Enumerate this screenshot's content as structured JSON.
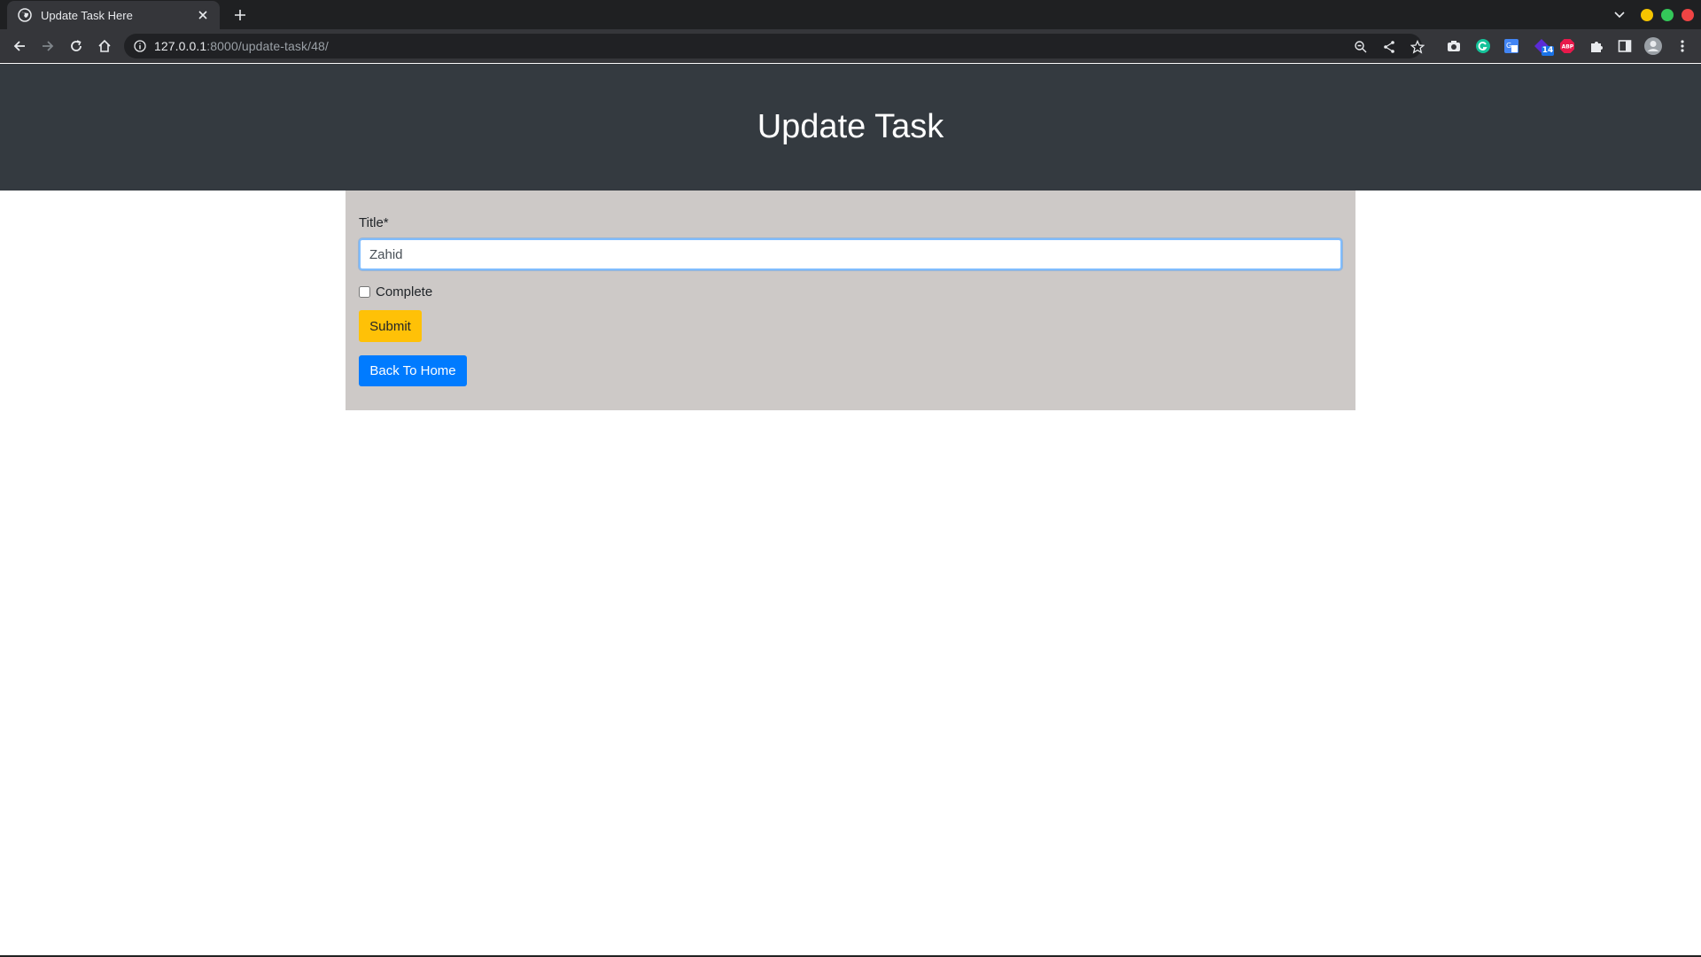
{
  "browser": {
    "tab_title": "Update Task Here",
    "url_host": "127.0.0.1",
    "url_path": ":8000/update-task/48/",
    "extension_badge": "14",
    "window_colors": {
      "minimize": "#f5c400",
      "maximize": "#34c759",
      "close": "#ef4444"
    }
  },
  "page": {
    "heading": "Update Task",
    "form": {
      "title_label": "Title*",
      "title_value": "Zahid",
      "complete_label": "Complete",
      "submit_label": "Submit",
      "back_label": "Back To Home"
    }
  },
  "colors": {
    "hero_bg": "#343a40",
    "card_bg": "#cdc9c7",
    "submit_bg": "#ffc107",
    "home_bg": "#007bff"
  }
}
